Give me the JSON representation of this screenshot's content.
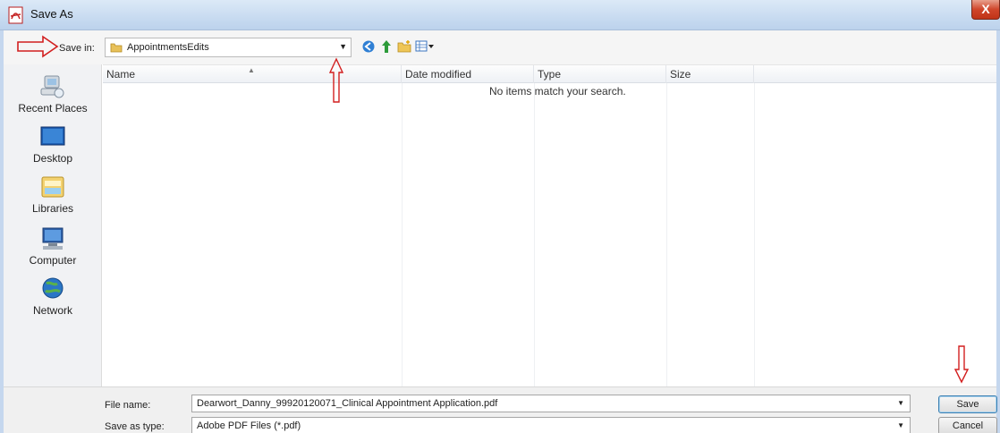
{
  "window": {
    "title": "Save As",
    "close_glyph": "X",
    "icon": "pdf-icon"
  },
  "toolbar": {
    "save_in_label": "Save in:",
    "save_in_value": "AppointmentsEdits",
    "icons": [
      "back-icon",
      "up-folder-icon",
      "new-folder-icon",
      "view-menu-icon"
    ]
  },
  "places": [
    {
      "label": "Recent Places",
      "icon": "recent-places-icon"
    },
    {
      "label": "Desktop",
      "icon": "desktop-icon"
    },
    {
      "label": "Libraries",
      "icon": "libraries-icon"
    },
    {
      "label": "Computer",
      "icon": "computer-icon"
    },
    {
      "label": "Network",
      "icon": "network-icon"
    }
  ],
  "file_list": {
    "columns": [
      "Name",
      "Date modified",
      "Type",
      "Size"
    ],
    "empty_message": "No items match your search."
  },
  "form": {
    "file_name_label": "File name:",
    "file_name_value": "Dearwort_Danny_99920120071_Clinical Appointment Application.pdf",
    "save_type_label": "Save as type:",
    "save_type_value": "Adobe PDF Files (*.pdf)"
  },
  "buttons": {
    "save": "Save",
    "cancel": "Cancel"
  },
  "colors": {
    "annotation_arrow": "#d21f1f",
    "title_bar": "#c9dcf1",
    "close_button": "#d0462b"
  }
}
